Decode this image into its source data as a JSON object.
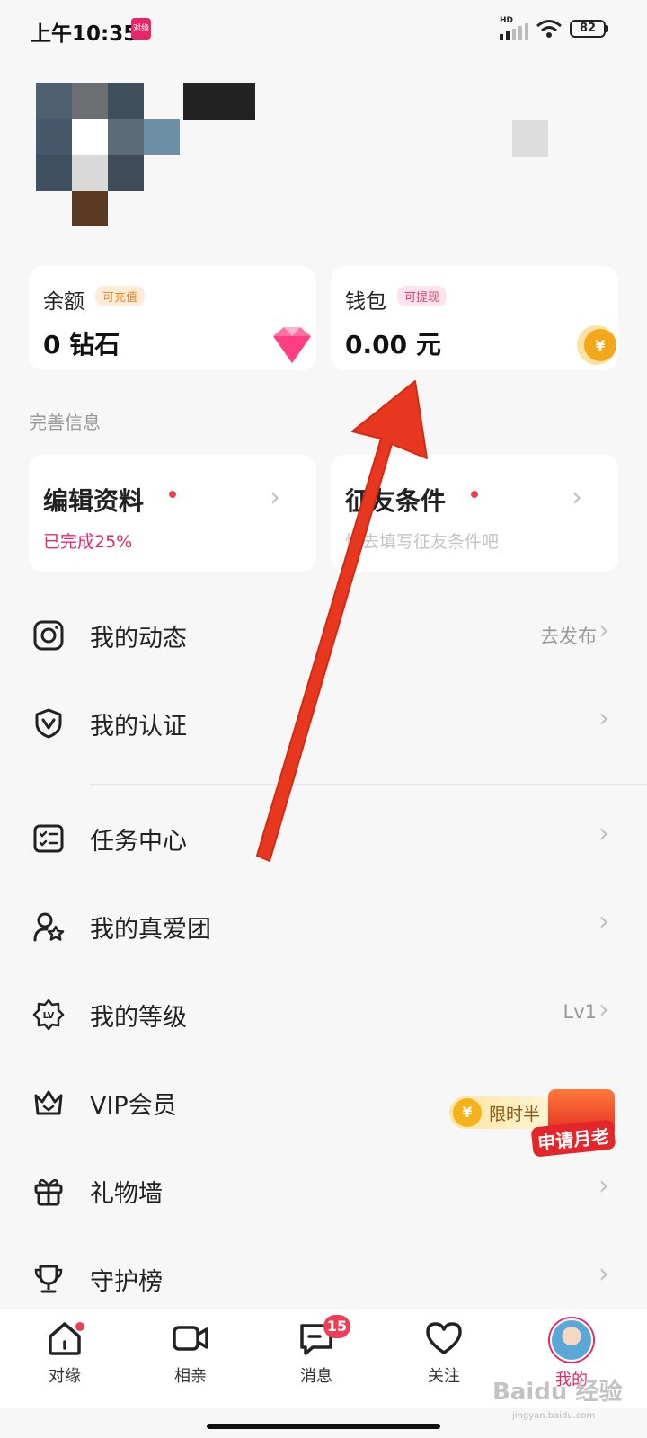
{
  "status_bar": {
    "time": "上午10:35",
    "app_badge": "对缘",
    "network": "HD",
    "battery": "82"
  },
  "profile": {
    "avatar": "pixelated-avatar",
    "name": ""
  },
  "balance_card": {
    "title": "余额",
    "tag": "可充值",
    "value": "0 钻石",
    "icon": "diamond-icon"
  },
  "wallet_card": {
    "title": "钱包",
    "tag": "可提现",
    "value": "0.00 元",
    "icon": "coin-icon"
  },
  "section_label": "完善信息",
  "info_cards": [
    {
      "title": "编辑资料",
      "subtitle": "已完成25%"
    },
    {
      "title": "征友条件",
      "subtitle": "快去填写征友条件吧"
    }
  ],
  "menu": [
    {
      "label": "我的动态",
      "right": "去发布",
      "icon": "camera-icon"
    },
    {
      "label": "我的认证",
      "right": "",
      "icon": "shield-v-icon"
    },
    {
      "label": "任务中心",
      "right": "",
      "icon": "checklist-icon"
    },
    {
      "label": "我的真爱团",
      "right": "",
      "icon": "user-star-icon"
    },
    {
      "label": "我的等级",
      "right": "Lv1",
      "icon": "level-badge-icon"
    },
    {
      "label": "VIP会员",
      "right": "",
      "icon": "crown-icon"
    },
    {
      "label": "礼物墙",
      "right": "",
      "icon": "gift-icon"
    },
    {
      "label": "守护榜",
      "right": "",
      "icon": "trophy-icon"
    }
  ],
  "vip_promo": {
    "text": "限时半",
    "gift_label": "申请月老"
  },
  "bottom_nav": [
    {
      "label": "对缘",
      "icon": "home-icon"
    },
    {
      "label": "相亲",
      "icon": "video-icon"
    },
    {
      "label": "消息",
      "icon": "message-icon",
      "badge": "15"
    },
    {
      "label": "关注",
      "icon": "heart-icon"
    },
    {
      "label": "我的",
      "icon": "avatar-icon"
    }
  ],
  "watermark": {
    "text": "Baidu 经验",
    "url": "jingyan.baidu.com"
  },
  "colors": {
    "accent": "#e8266b",
    "red_dot": "#ef3e55",
    "arrow": "#e8371f"
  }
}
